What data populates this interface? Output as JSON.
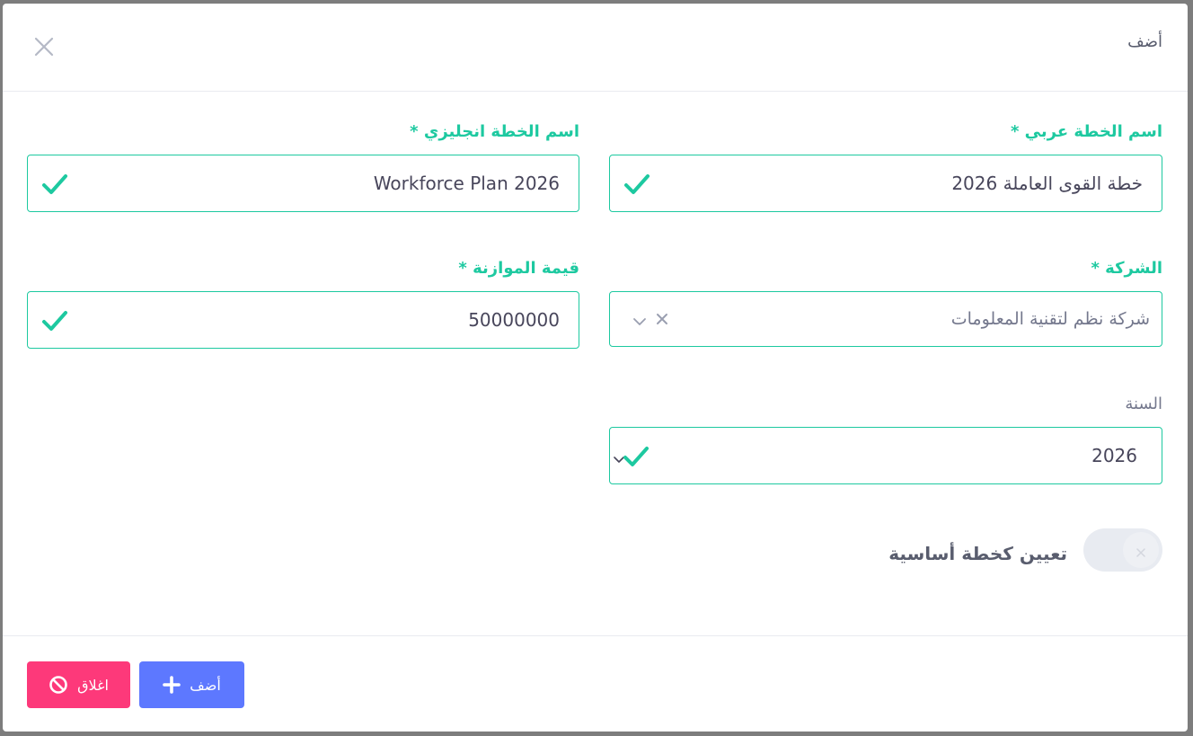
{
  "modal": {
    "title": "أضف"
  },
  "fields": {
    "plan_name_ar": {
      "label": "اسم الخطة عربي",
      "value": "خطة القوى العاملة 2026"
    },
    "plan_name_en": {
      "label": "اسم الخطة انجليزي",
      "value": "Workforce Plan 2026"
    },
    "company": {
      "label": "الشركة",
      "value": "شركة نظم لتقنية المعلومات"
    },
    "budget": {
      "label": "قيمة الموازنة",
      "value": "50000000"
    },
    "year": {
      "label": "السنة",
      "value": "2026"
    },
    "required_mark": "*"
  },
  "toggle": {
    "label": "تعيين كخطة أساسية",
    "checked": false
  },
  "footer": {
    "add_label": "أضف",
    "close_label": "اغلاق"
  },
  "colors": {
    "valid": "#1dc9a0",
    "primary": "#5d78ff",
    "danger": "#fd397a"
  },
  "icons": [
    "close-icon",
    "check-icon",
    "clear-icon",
    "chevron-down-icon",
    "plus-icon",
    "ban-icon"
  ]
}
